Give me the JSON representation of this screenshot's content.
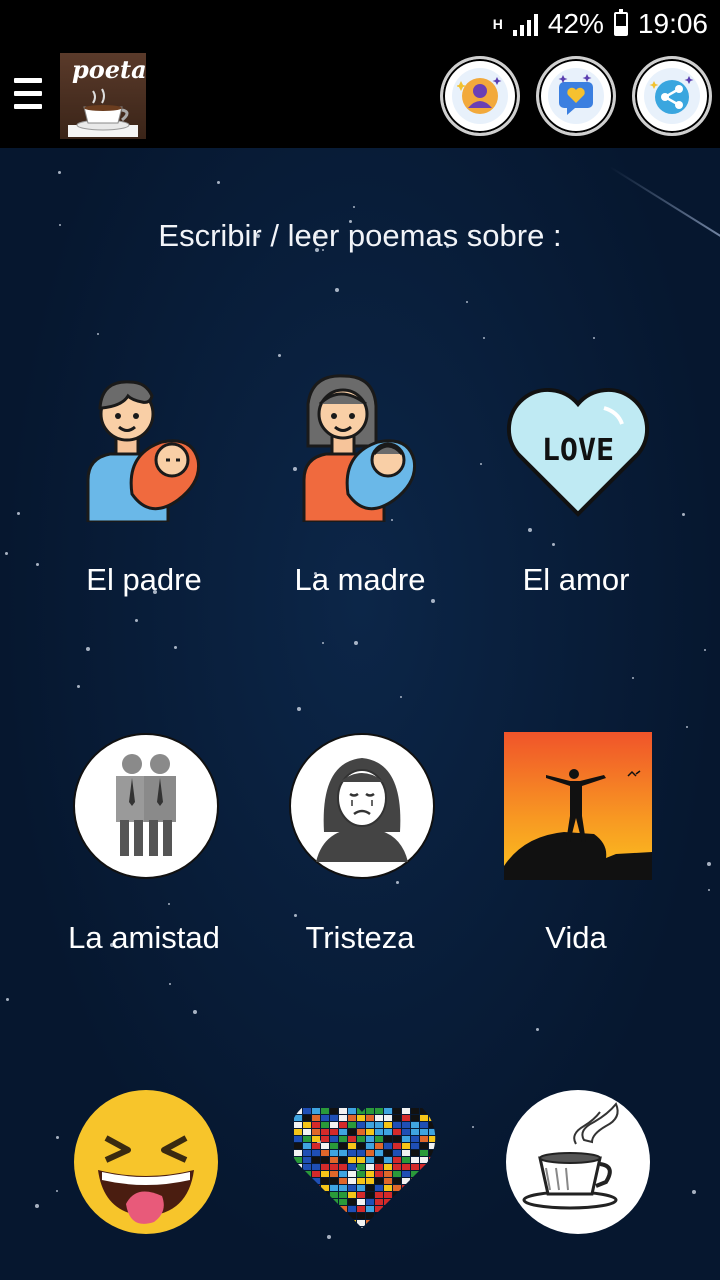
{
  "status_bar": {
    "network": "H",
    "battery": "42%",
    "battery_level": 0.42,
    "time": "19:06"
  },
  "app_bar": {
    "logo_text": "poeta",
    "menu_icon": "hamburger-menu-icon",
    "actions": [
      {
        "name": "profile-button",
        "icon": "user-profile-icon"
      },
      {
        "name": "messages-button",
        "icon": "heart-message-icon"
      },
      {
        "name": "share-button",
        "icon": "share-icon"
      }
    ]
  },
  "main": {
    "heading": "Escribir / leer poemas sobre :",
    "topics": [
      {
        "label": "El padre",
        "icon": "father-with-baby-icon"
      },
      {
        "label": "La madre",
        "icon": "mother-with-baby-icon"
      },
      {
        "label": "El amor",
        "icon": "love-heart-icon",
        "art_text": "LOVE"
      },
      {
        "label": "La amistad",
        "icon": "two-friends-icon"
      },
      {
        "label": "Tristeza",
        "icon": "sad-woman-icon"
      },
      {
        "label": "Vida",
        "icon": "sunset-silhouette-icon"
      },
      {
        "label": "",
        "icon": "laughing-emoji-icon"
      },
      {
        "label": "",
        "icon": "flags-heart-icon"
      },
      {
        "label": "",
        "icon": "coffee-cup-icon"
      }
    ]
  },
  "colors": {
    "background": "#06172f",
    "app_bar": "#000000",
    "text": "#ffffff",
    "love_heart": "#bfeaf3"
  }
}
